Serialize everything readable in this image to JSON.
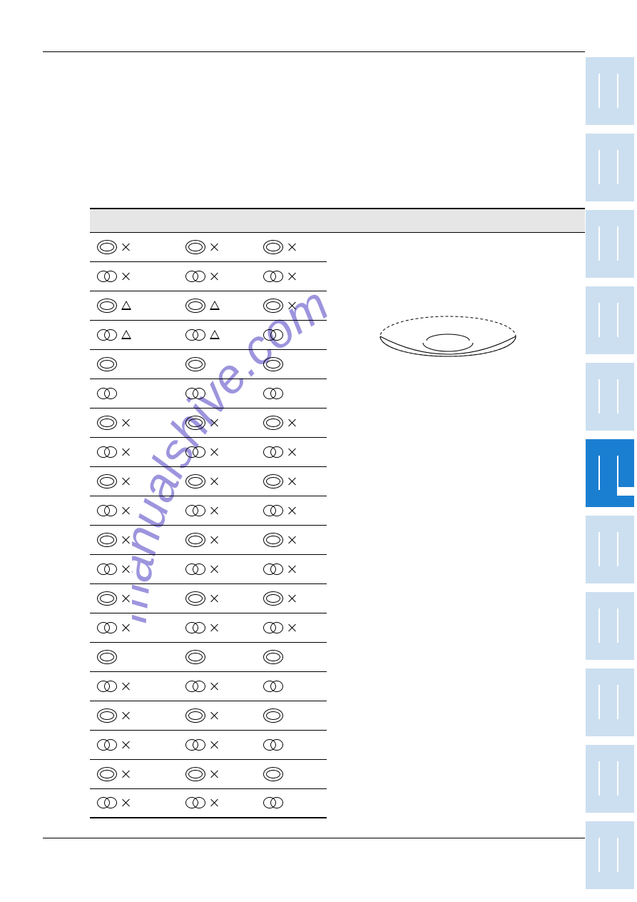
{
  "icons": {
    "ring": "double-oval-icon",
    "twooval": "two-ovals-icon",
    "cross": "cross-icon",
    "tri": "triangle-icon"
  },
  "table": {
    "header": [
      "",
      "",
      "",
      ""
    ],
    "rows": [
      {
        "c1": [
          "ring",
          "cross"
        ],
        "c2": [
          "ring",
          "cross"
        ],
        "c3": [
          "ring",
          "cross"
        ]
      },
      {
        "c1": [
          "twooval",
          "cross"
        ],
        "c2": [
          "twooval",
          "cross"
        ],
        "c3": [
          "twooval",
          "cross"
        ]
      },
      {
        "c1": [
          "ring",
          "tri"
        ],
        "c2": [
          "ring",
          "tri"
        ],
        "c3": [
          "ring",
          "cross"
        ]
      },
      {
        "c1": [
          "twooval",
          "tri"
        ],
        "c2": [
          "twooval",
          "tri"
        ],
        "c3": [
          "twooval"
        ]
      },
      {
        "c1": [
          "ring"
        ],
        "c2": [
          "ring"
        ],
        "c3": [
          "ring"
        ]
      },
      {
        "c1": [
          "twooval"
        ],
        "c2": [
          "twooval"
        ],
        "c3": [
          "twooval"
        ]
      },
      {
        "c1": [
          "ring",
          "cross"
        ],
        "c2": [
          "ring",
          "cross"
        ],
        "c3": [
          "ring",
          "cross"
        ]
      },
      {
        "c1": [
          "twooval",
          "cross"
        ],
        "c2": [
          "twooval",
          "cross"
        ],
        "c3": [
          "twooval",
          "cross"
        ]
      },
      {
        "c1": [
          "ring",
          "cross"
        ],
        "c2": [
          "ring",
          "cross"
        ],
        "c3": [
          "ring",
          "cross"
        ]
      },
      {
        "c1": [
          "twooval",
          "cross"
        ],
        "c2": [
          "twooval",
          "cross"
        ],
        "c3": [
          "twooval",
          "cross"
        ]
      },
      {
        "c1": [
          "ring",
          "cross"
        ],
        "c2": [
          "ring",
          "cross"
        ],
        "c3": [
          "ring",
          "cross"
        ]
      },
      {
        "c1": [
          "twooval",
          "cross"
        ],
        "c2": [
          "twooval",
          "cross"
        ],
        "c3": [
          "twooval",
          "cross"
        ]
      },
      {
        "c1": [
          "ring",
          "cross"
        ],
        "c2": [
          "ring",
          "cross"
        ],
        "c3": [
          "ring",
          "cross"
        ]
      },
      {
        "c1": [
          "twooval",
          "cross"
        ],
        "c2": [
          "twooval",
          "cross"
        ],
        "c3": [
          "twooval",
          "cross"
        ]
      },
      {
        "c1": [
          "ring"
        ],
        "c2": [
          "ring"
        ],
        "c3": [
          "ring"
        ]
      },
      {
        "c1": [
          "twooval",
          "cross"
        ],
        "c2": [
          "twooval",
          "cross"
        ],
        "c3": [
          "twooval"
        ]
      },
      {
        "c1": [
          "ring",
          "cross"
        ],
        "c2": [
          "ring",
          "cross"
        ],
        "c3": [
          "ring"
        ]
      },
      {
        "c1": [
          "twooval",
          "cross"
        ],
        "c2": [
          "twooval",
          "cross"
        ],
        "c3": [
          "twooval"
        ]
      },
      {
        "c1": [
          "ring",
          "cross"
        ],
        "c2": [
          "ring",
          "cross"
        ],
        "c3": [
          "ring"
        ]
      },
      {
        "c1": [
          "twooval",
          "cross"
        ],
        "c2": [
          "twooval",
          "cross"
        ],
        "c3": [
          "twooval"
        ]
      }
    ]
  },
  "watermark_text": "manualshive.com",
  "tabs_count": 11,
  "active_tab_index": 5
}
